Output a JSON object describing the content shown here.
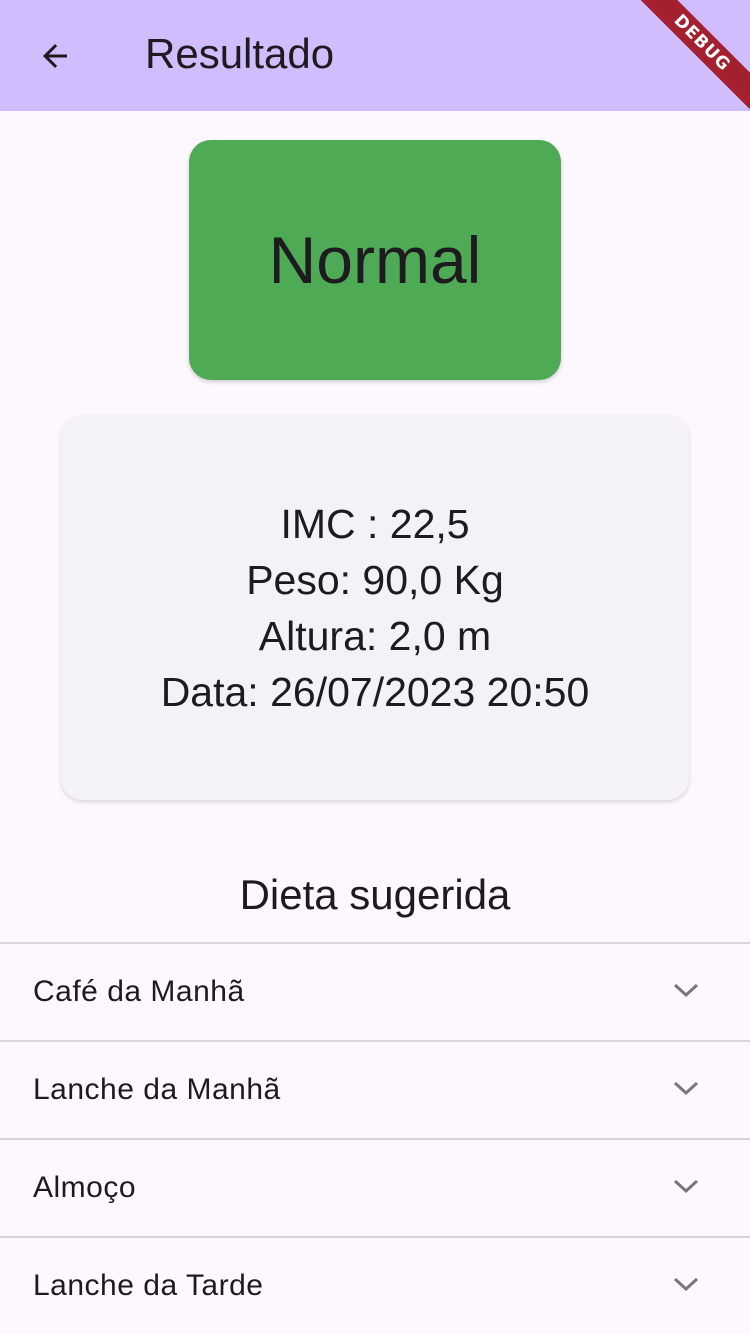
{
  "appbar": {
    "title": "Resultado",
    "back_icon": "arrow-back-icon",
    "color": "#d1bcfe"
  },
  "debug_banner": "DEBUG",
  "result": {
    "status": "Normal",
    "status_color": "#4faa55"
  },
  "info": {
    "imc": "IMC : 22,5",
    "peso": "Peso: 90,0 Kg",
    "altura": "Altura: 2,0 m",
    "data": "Data: 26/07/2023 20:50"
  },
  "diet": {
    "title": "Dieta sugerida",
    "items": [
      {
        "label": "Café da Manhã",
        "icon": "chevron-down-icon"
      },
      {
        "label": "Lanche da Manhã",
        "icon": "chevron-down-icon"
      },
      {
        "label": "Almoço",
        "icon": "chevron-down-icon"
      },
      {
        "label": "Lanche da Tarde",
        "icon": "chevron-down-icon"
      }
    ]
  }
}
